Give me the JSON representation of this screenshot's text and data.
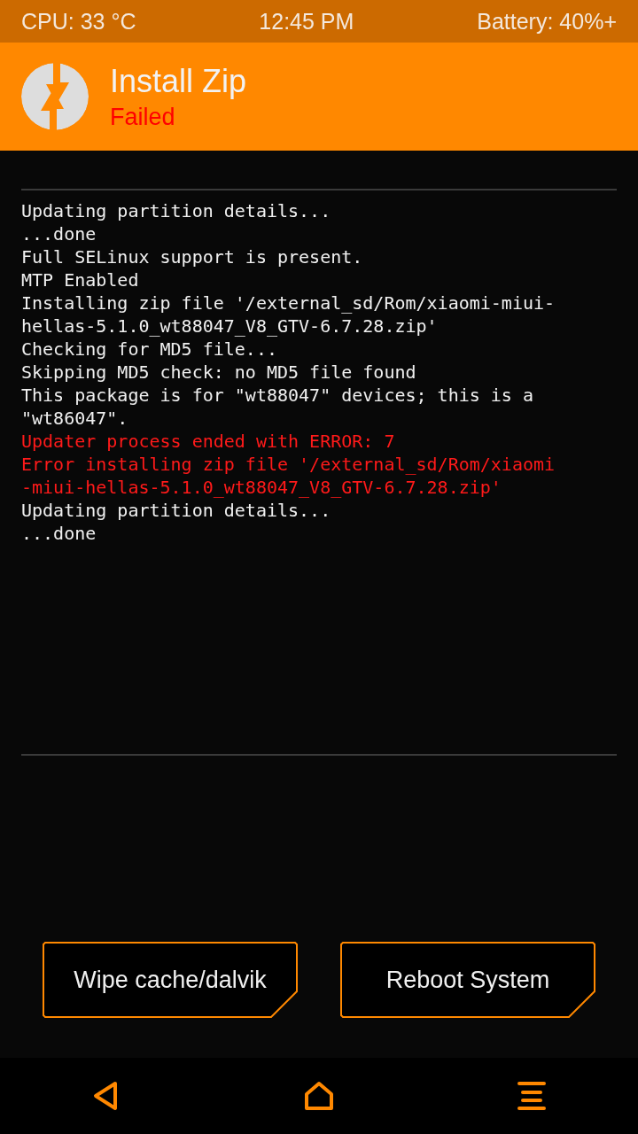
{
  "status_bar": {
    "cpu": "CPU: 33 °C",
    "time": "12:45 PM",
    "battery": "Battery: 40%+"
  },
  "header": {
    "title": "Install Zip",
    "status": "Failed"
  },
  "log": [
    {
      "kind": "info",
      "text": "Updating partition details..."
    },
    {
      "kind": "info",
      "text": "...done"
    },
    {
      "kind": "info",
      "text": "Full SELinux support is present."
    },
    {
      "kind": "info",
      "text": "MTP Enabled"
    },
    {
      "kind": "info",
      "text": "Installing zip file '/external_sd/Rom/xiaomi-miui-"
    },
    {
      "kind": "info",
      "text": "hellas-5.1.0_wt88047_V8_GTV-6.7.28.zip'"
    },
    {
      "kind": "info",
      "text": "Checking for MD5 file..."
    },
    {
      "kind": "info",
      "text": "Skipping MD5 check: no MD5 file found"
    },
    {
      "kind": "info",
      "text": "This package is for \"wt88047\" devices; this is a"
    },
    {
      "kind": "info",
      "text": "\"wt86047\"."
    },
    {
      "kind": "error",
      "text": "Updater process ended with ERROR: 7"
    },
    {
      "kind": "error",
      "text": "Error installing zip file '/external_sd/Rom/xiaomi"
    },
    {
      "kind": "error",
      "text": "-miui-hellas-5.1.0_wt88047_V8_GTV-6.7.28.zip'"
    },
    {
      "kind": "info",
      "text": "Updating partition details..."
    },
    {
      "kind": "info",
      "text": "...done"
    }
  ],
  "buttons": [
    "Wipe cache/dalvik",
    "Reboot System"
  ],
  "nav": [
    {
      "kind": "back"
    },
    {
      "kind": "home"
    },
    {
      "kind": "menu"
    }
  ]
}
